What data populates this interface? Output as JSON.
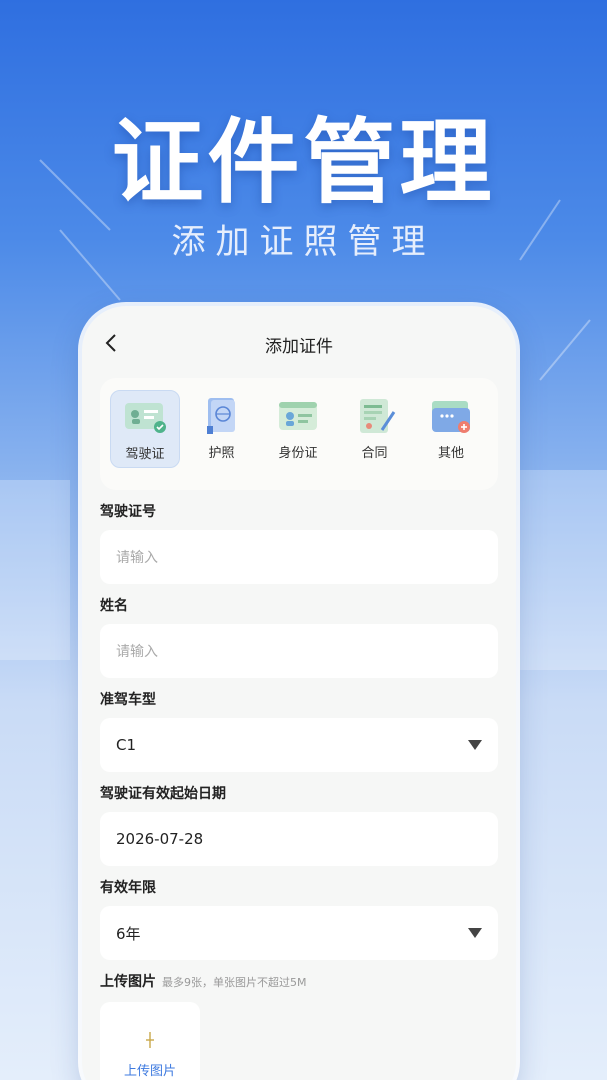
{
  "hero": {
    "title": "证件管理",
    "subtitle": "添加证照管理"
  },
  "screen": {
    "title": "添加证件",
    "categories": [
      {
        "label": "驾驶证",
        "icon": "drivers-license-icon",
        "active": true
      },
      {
        "label": "护照",
        "icon": "passport-icon",
        "active": false
      },
      {
        "label": "身份证",
        "icon": "id-card-icon",
        "active": false
      },
      {
        "label": "合同",
        "icon": "contract-icon",
        "active": false
      },
      {
        "label": "其他",
        "icon": "other-folder-icon",
        "active": false
      }
    ],
    "fields": {
      "license_no": {
        "label": "驾驶证号",
        "placeholder": "请输入"
      },
      "name": {
        "label": "姓名",
        "placeholder": "请输入"
      },
      "vehicle_type": {
        "label": "准驾车型",
        "value": "C1"
      },
      "start_date": {
        "label": "驾驶证有效起始日期",
        "value": "2026-07-28"
      },
      "validity": {
        "label": "有效年限",
        "value": "6年"
      },
      "upload": {
        "label": "上传图片",
        "hint": "最多9张，单张图片不超过5M",
        "button": "上传图片"
      }
    }
  },
  "colors": {
    "accent": "#3f7be0",
    "hero_bg": "#2f6fe0",
    "active_tab_bg": "#dfe9f7"
  }
}
